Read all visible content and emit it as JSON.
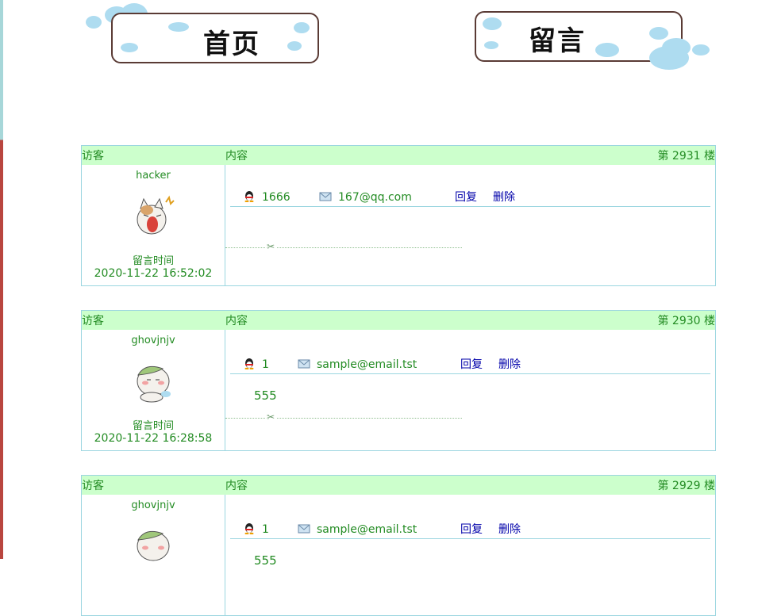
{
  "nav": {
    "home_label": "首页",
    "message_label": "留言"
  },
  "table_headers": {
    "visitor": "访客",
    "content": "内容"
  },
  "time_label": "留言时间",
  "actions": {
    "reply": "回复",
    "delete": "删除"
  },
  "messages": [
    {
      "floor_label": "第 2931 楼",
      "username": "hacker",
      "avatar": "shouting-cat-avatar",
      "qq": "1666",
      "email": "167@qq.com",
      "content": "",
      "time": "2020-11-22 16:52:02"
    },
    {
      "floor_label": "第 2930 楼",
      "username": "ghovjnjv",
      "avatar": "blushing-cat-avatar",
      "qq": "1",
      "email": "sample@email.tst",
      "content": "555",
      "time": "2020-11-22 16:28:58"
    },
    {
      "floor_label": "第 2929 楼",
      "username": "ghovjnjv",
      "avatar": "blushing-cat-avatar",
      "qq": "1",
      "email": "sample@email.tst",
      "content": "555",
      "time": ""
    }
  ]
}
